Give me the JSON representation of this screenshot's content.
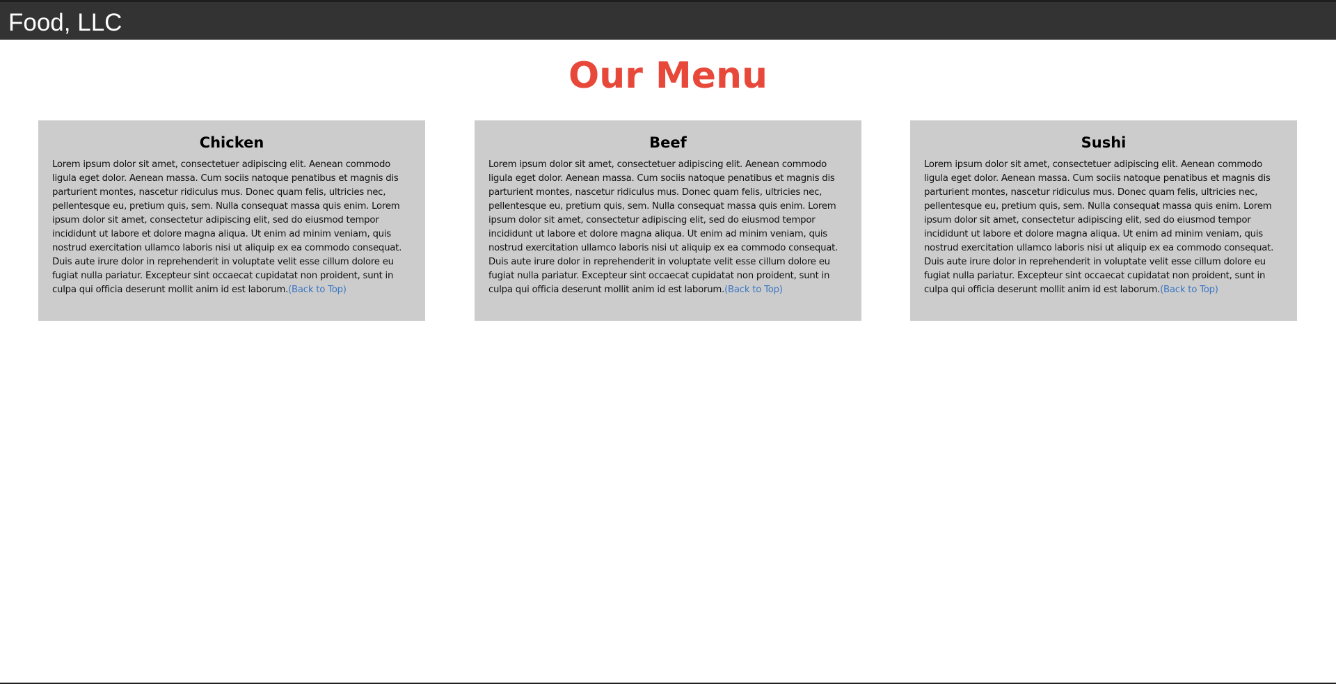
{
  "header": {
    "brand": "Food, LLC"
  },
  "main": {
    "title": "Our Menu",
    "cards": [
      {
        "title": "Chicken",
        "text": "Lorem ipsum dolor sit amet, consectetuer adipiscing elit. Aenean commodo ligula eget dolor. Aenean massa. Cum sociis natoque penatibus et magnis dis parturient montes, nascetur ridiculus mus. Donec quam felis, ultricies nec, pellentesque eu, pretium quis, sem. Nulla consequat massa quis enim. Lorem ipsum dolor sit amet, consectetur adipiscing elit, sed do eiusmod tempor incididunt ut labore et dolore magna aliqua. Ut enim ad minim veniam, quis nostrud exercitation ullamco laboris nisi ut aliquip ex ea commodo consequat. Duis aute irure dolor in reprehenderit in voluptate velit esse cillum dolore eu fugiat nulla pariatur. Excepteur sint occaecat cupidatat non proident, sunt in culpa qui officia deserunt mollit anim id est laborum.",
        "link": "(Back to Top)"
      },
      {
        "title": "Beef",
        "text": "Lorem ipsum dolor sit amet, consectetuer adipiscing elit. Aenean commodo ligula eget dolor. Aenean massa. Cum sociis natoque penatibus et magnis dis parturient montes, nascetur ridiculus mus. Donec quam felis, ultricies nec, pellentesque eu, pretium quis, sem. Nulla consequat massa quis enim. Lorem ipsum dolor sit amet, consectetur adipiscing elit, sed do eiusmod tempor incididunt ut labore et dolore magna aliqua. Ut enim ad minim veniam, quis nostrud exercitation ullamco laboris nisi ut aliquip ex ea commodo consequat. Duis aute irure dolor in reprehenderit in voluptate velit esse cillum dolore eu fugiat nulla pariatur. Excepteur sint occaecat cupidatat non proident, sunt in culpa qui officia deserunt mollit anim id est laborum.",
        "link": "(Back to Top)"
      },
      {
        "title": "Sushi",
        "text": "Lorem ipsum dolor sit amet, consectetuer adipiscing elit. Aenean commodo ligula eget dolor. Aenean massa. Cum sociis natoque penatibus et magnis dis parturient montes, nascetur ridiculus mus. Donec quam felis, ultricies nec, pellentesque eu, pretium quis, sem. Nulla consequat massa quis enim. Lorem ipsum dolor sit amet, consectetur adipiscing elit, sed do eiusmod tempor incididunt ut labore et dolore magna aliqua. Ut enim ad minim veniam, quis nostrud exercitation ullamco laboris nisi ut aliquip ex ea commodo consequat. Duis aute irure dolor in reprehenderit in voluptate velit esse cillum dolore eu fugiat nulla pariatur. Excepteur sint occaecat cupidatat non proident, sunt in culpa qui officia deserunt mollit anim id est laborum.",
        "link": "(Back to Top)"
      }
    ]
  },
  "colors": {
    "header_bg": "#333333",
    "title": "#e8483a",
    "card_bg": "#cccccc",
    "link": "#3b77c4"
  }
}
